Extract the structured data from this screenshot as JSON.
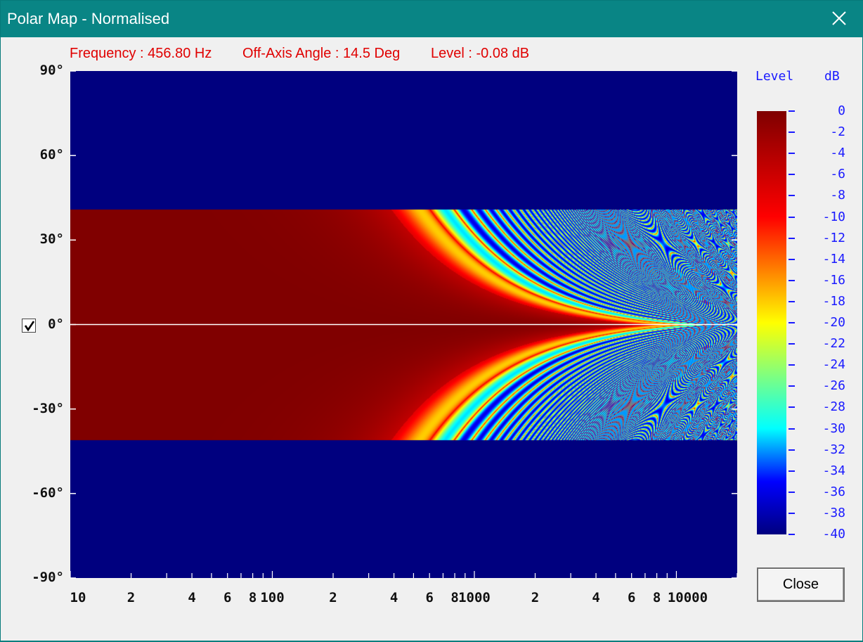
{
  "window": {
    "title": "Polar Map - Normalised",
    "close_glyph": "✕"
  },
  "readout": {
    "frequency": "Frequency : 456.80 Hz",
    "angle": "Off-Axis Angle : 14.5 Deg",
    "level": "Level : -0.08 dB"
  },
  "y_axis": {
    "labels": [
      "90°",
      "60°",
      "30°",
      "0°",
      "-30°",
      "-60°",
      "-90°"
    ]
  },
  "x_axis": {
    "labels": [
      "10",
      "2",
      "4",
      "6",
      "8",
      "100",
      "2",
      "4",
      "6",
      "8",
      "1000",
      "2",
      "4",
      "6",
      "8",
      "10000"
    ]
  },
  "reference_checkbox": {
    "checked": true,
    "glyph": "✔"
  },
  "legend": {
    "title_left": "Level",
    "title_right": "dB",
    "labels": [
      "0",
      "-2",
      "-4",
      "-6",
      "-8",
      "-10",
      "-12",
      "-14",
      "-16",
      "-18",
      "-20",
      "-22",
      "-24",
      "-26",
      "-28",
      "-30",
      "-32",
      "-34",
      "-36",
      "-38",
      "-40"
    ]
  },
  "buttons": {
    "close": "Close"
  },
  "chart_data": {
    "type": "heatmap",
    "x_scale": "log",
    "xlim": [
      10,
      20000
    ],
    "ylim": [
      -90,
      90
    ],
    "zlim": [
      -40,
      0
    ],
    "x_unit": "Hz",
    "y_unit": "Deg",
    "z_unit": "dB",
    "colormap": "jet",
    "beam_edge_deg": 41,
    "reference_line_deg": 0,
    "cursor": {
      "frequency_hz": 456.8,
      "angle_deg": 14.5,
      "level_db": -0.08
    },
    "colors": {
      "outside": "#00007f",
      "reference_line": "#ffffff"
    }
  }
}
